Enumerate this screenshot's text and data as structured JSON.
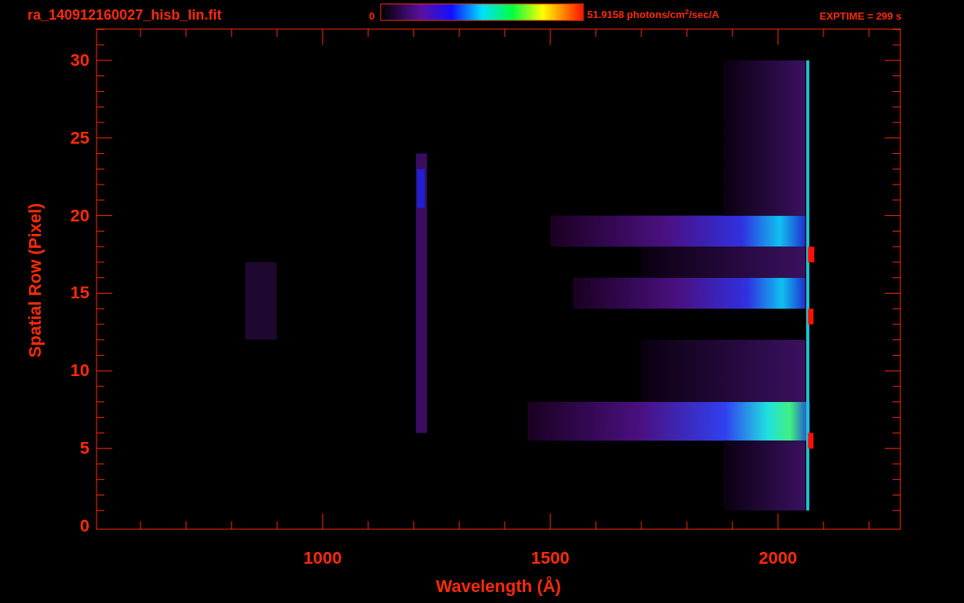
{
  "plot": {
    "title": "ra_140912160027_hisb_lin.fit",
    "colorbar": {
      "min_label": "0",
      "max_label": "51.9158 photons/cm$^{2}$/sec/A"
    },
    "exposure": "EXPTIME = 299 s",
    "xlabel": "Wavelength (Å)",
    "ylabel": "Spatial Row (Pixel)",
    "xtick_labels": [
      "1000",
      "1500",
      "2000"
    ],
    "ytick_labels": [
      "30",
      "25",
      "20",
      "15",
      "10",
      "5",
      "0"
    ]
  }
}
